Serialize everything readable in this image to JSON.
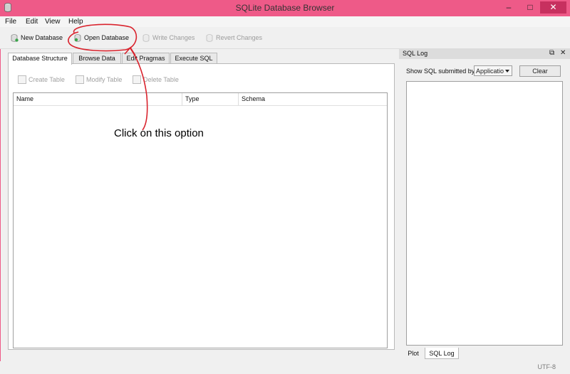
{
  "window": {
    "title": "SQLite Database Browser"
  },
  "menu": [
    "File",
    "Edit",
    "View",
    "Help"
  ],
  "toolbar": {
    "new_db": "New Database",
    "open_db": "Open Database",
    "write_changes": "Write Changes",
    "revert_changes": "Revert Changes"
  },
  "tabs": [
    "Database Structure",
    "Browse Data",
    "Edit Pragmas",
    "Execute SQL"
  ],
  "structure": {
    "create_table": "Create Table",
    "modify_table": "Modify Table",
    "delete_table": "Delete Table",
    "columns": [
      "Name",
      "Type",
      "Schema"
    ]
  },
  "annotation": {
    "text": "Click on this option"
  },
  "sqllog": {
    "title": "SQL Log",
    "show_label": "Show SQL submitted by",
    "submitted_by": "Applicatio",
    "clear": "Clear"
  },
  "bottom_tabs": [
    "Plot",
    "SQL Log"
  ],
  "status": {
    "encoding": "UTF-8"
  },
  "colors": {
    "titlebar": "#ee5a88",
    "annotation": "#d9232d"
  }
}
